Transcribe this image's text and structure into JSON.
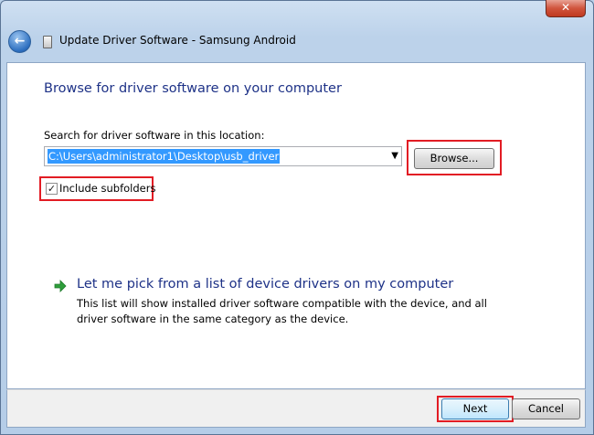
{
  "window": {
    "title": "Update Driver Software - Samsung Android",
    "close_glyph": "✕"
  },
  "nav": {
    "back_icon": "back-arrow-icon"
  },
  "page": {
    "heading": "Browse for driver software on your computer",
    "search_label": "Search for driver software in this location:",
    "path_value": "C:\\Users\\administrator1\\Desktop\\usb_driver",
    "browse_label": "Browse...",
    "include_subfolders_label": "Include subfolders",
    "include_subfolders_checked": true,
    "pick_title": "Let me pick from a list of device drivers on my computer",
    "pick_description": "This list will show installed driver software compatible with the device, and all driver software in the same category as the device."
  },
  "footer": {
    "next_label": "Next",
    "cancel_label": "Cancel"
  },
  "colors": {
    "heading": "#1e3287",
    "highlight_box": "#e21c24",
    "selection": "#3399ff",
    "arrow_green": "#2e9e3a"
  }
}
